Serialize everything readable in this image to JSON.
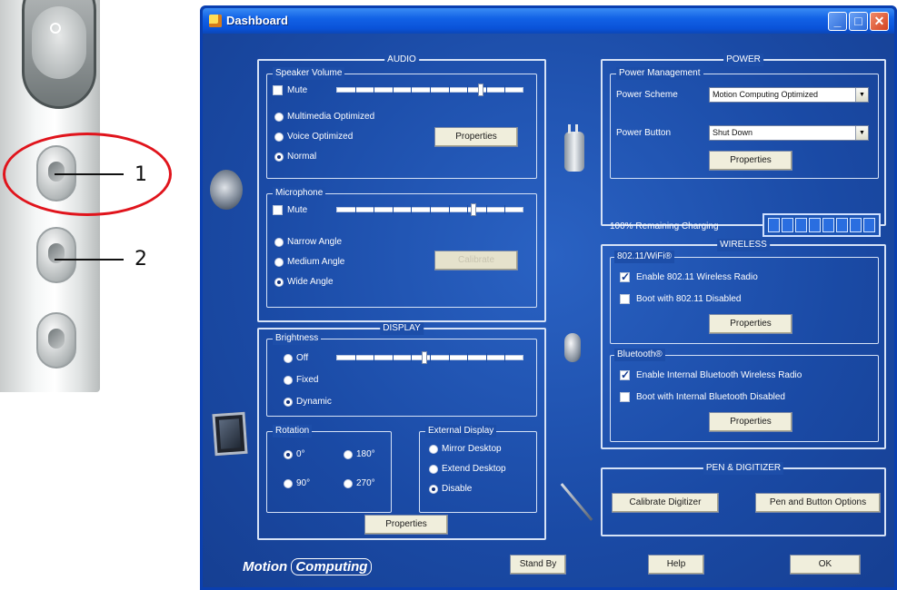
{
  "callouts": [
    "1",
    "2"
  ],
  "window": {
    "title": "Dashboard",
    "controls": {
      "minimize": "_",
      "maximize": "□",
      "close": "✕"
    }
  },
  "audio": {
    "title": "AUDIO",
    "speaker_volume": {
      "title": "Speaker Volume",
      "mute_label": "Mute",
      "mute_checked": false,
      "volume_level": 0.78,
      "modes": [
        "Multimedia Optimized",
        "Voice Optimized",
        "Normal"
      ],
      "selected_mode": "Normal",
      "properties_label": "Properties"
    },
    "microphone": {
      "title": "Microphone",
      "mute_label": "Mute",
      "mute_checked": false,
      "level": 0.74,
      "modes": [
        "Narrow Angle",
        "Medium Angle",
        "Wide Angle"
      ],
      "selected_mode": "Wide Angle",
      "calibrate_label": "Calibrate"
    }
  },
  "display": {
    "title": "DISPLAY",
    "brightness": {
      "title": "Brightness",
      "modes": [
        "Off",
        "Fixed",
        "Dynamic"
      ],
      "selected_mode": "Dynamic",
      "level": 0.47
    },
    "rotation": {
      "title": "Rotation",
      "options": [
        "0°",
        "90°",
        "180°",
        "270°"
      ],
      "selected": "0°"
    },
    "external_display": {
      "title": "External Display",
      "options": [
        "Mirror Desktop",
        "Extend Desktop",
        "Disable"
      ],
      "selected": "Disable"
    },
    "properties_label": "Properties"
  },
  "power": {
    "title": "POWER",
    "management": {
      "title": "Power Management",
      "scheme_label": "Power Scheme",
      "scheme_value": "Motion Computing Optimized",
      "button_label": "Power Button",
      "button_value": "Shut Down",
      "properties_label": "Properties"
    },
    "battery_status": "100% Remaining  Charging",
    "battery_cells": 8,
    "battery_level": 1.0
  },
  "wireless": {
    "title": "WIRELESS",
    "wifi": {
      "title": "802.11/WiFi®",
      "enable_label": "Enable 802.11 Wireless Radio",
      "enable_checked": true,
      "boot_label": "Boot with 802.11 Disabled",
      "boot_checked": false,
      "properties_label": "Properties"
    },
    "bluetooth": {
      "title": "Bluetooth®",
      "enable_label": "Enable Internal Bluetooth Wireless Radio",
      "enable_checked": true,
      "boot_label": "Boot with Internal Bluetooth Disabled",
      "boot_checked": false,
      "properties_label": "Properties"
    }
  },
  "pen": {
    "title": "PEN & DIGITIZER",
    "calibrate_label": "Calibrate Digitizer",
    "options_label": "Pen and Button Options"
  },
  "footer": {
    "logo_part1": "Motion",
    "logo_part2": "Computing",
    "standby_label": "Stand By",
    "help_label": "Help",
    "ok_label": "OK"
  },
  "icons": {
    "audio": "speaker-icon",
    "power": "power-plug-icon",
    "wireless": "wireless-icon",
    "display": "tablet-icon",
    "pen": "pen-icon"
  }
}
